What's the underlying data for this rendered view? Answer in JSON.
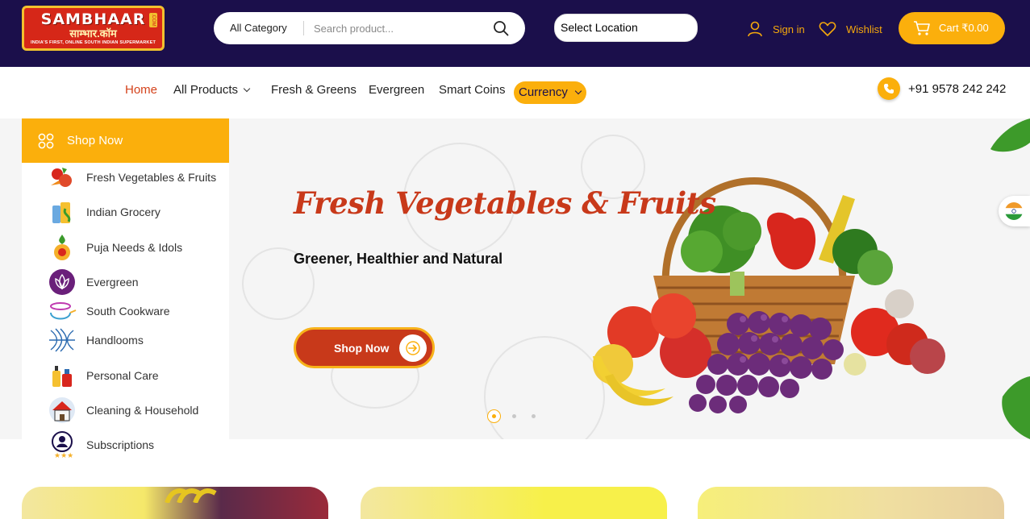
{
  "header": {
    "logo": {
      "name": "SAMBHAAR",
      "name_hindi": "साम्भार.कॉम",
      "tagline": "INDIA'S FIRST, ONLINE SOUTH INDIAN SUPERMARKET",
      "suffix": ".COM"
    },
    "search": {
      "category": "All Category",
      "placeholder": "Search product..."
    },
    "location": "Select Location",
    "signin": "Sign in",
    "wishlist": "Wishlist",
    "cart": "Cart ₹0.00"
  },
  "nav": {
    "items": [
      "Home",
      "All Products",
      "Fresh & Greens",
      "Evergreen",
      "Smart Coins"
    ],
    "currency": "Currency",
    "phone": "+91 9578 242 242"
  },
  "sidebar": {
    "title": "Shop Now",
    "categories": [
      "Fresh Vegetables & Fruits",
      "Indian Grocery",
      "Puja Needs & Idols",
      "Evergreen",
      "South Cookware",
      "Handlooms",
      "Personal Care",
      "Cleaning & Household",
      "Subscriptions"
    ]
  },
  "hero": {
    "title": "Fresh Vegetables & Fruits",
    "subtitle": "Greener, Healthier and Natural",
    "button": "Shop Now"
  },
  "colors": {
    "navy": "#1b0f4b",
    "accent": "#fbaf0c",
    "brand_red": "#c8391a"
  }
}
